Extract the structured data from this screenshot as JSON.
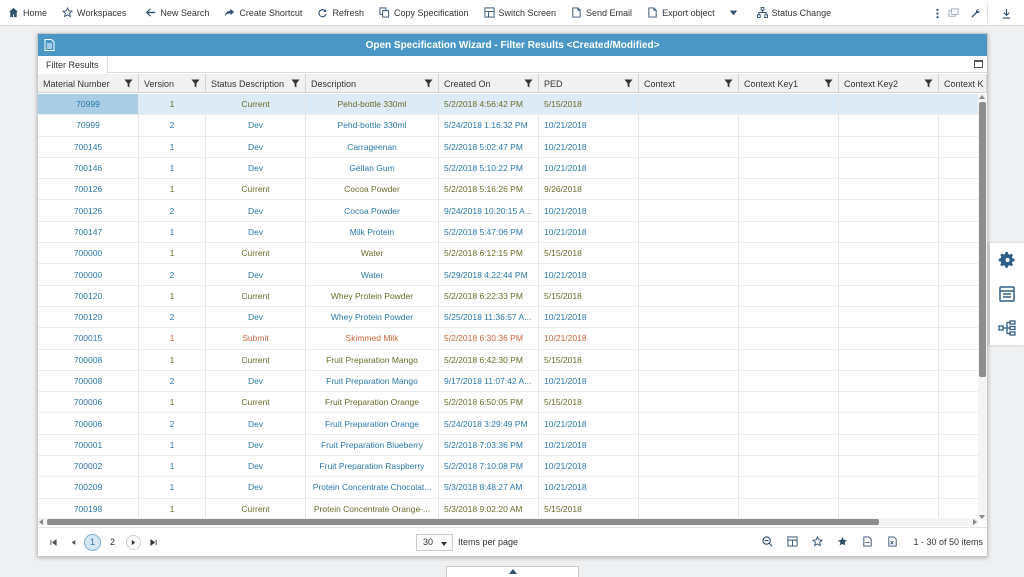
{
  "toolbar": {
    "items": [
      {
        "label": "Home",
        "icon": "home-icon"
      },
      {
        "label": "Workspaces",
        "icon": "star-icon"
      },
      {
        "label": "New Search",
        "icon": "arrow-left-icon"
      },
      {
        "label": "Create Shortcut",
        "icon": "shortcut-arrow-icon"
      },
      {
        "label": "Refresh",
        "icon": "refresh-icon"
      },
      {
        "label": "Copy Specification",
        "icon": "copy-icon"
      },
      {
        "label": "Switch Screen",
        "icon": "switch-screen-icon"
      },
      {
        "label": "Send Email",
        "icon": "email-icon"
      },
      {
        "label": "Export object",
        "icon": "export-icon"
      },
      {
        "label": "Status Change",
        "icon": "status-change-icon"
      }
    ]
  },
  "dialog": {
    "title": "Open Specification Wizard - Filter Results <Created/Modified>",
    "tab": "Filter Results"
  },
  "grid": {
    "columns": [
      "Material Number",
      "Version",
      "Status Description",
      "Description",
      "Created On",
      "PED",
      "Context",
      "Context Key1",
      "Context Key2",
      "Context K"
    ],
    "rows": [
      {
        "material": "70999",
        "version": "1",
        "status": "Current",
        "description": "Pehd-bottle 330ml",
        "created": "5/2/2018 4:56:42 PM",
        "ped": "5/15/2018",
        "color": "olive",
        "selected": true
      },
      {
        "material": "70999",
        "version": "2",
        "status": "Dev",
        "description": "Pehd-bottle 330ml",
        "created": "5/24/2018 1:16:32 PM",
        "ped": "10/21/2018",
        "color": "blue"
      },
      {
        "material": "700145",
        "version": "1",
        "status": "Dev",
        "description": "Carrageenan",
        "created": "5/2/2018 5:02:47 PM",
        "ped": "10/21/2018",
        "color": "blue"
      },
      {
        "material": "700146",
        "version": "1",
        "status": "Dev",
        "description": "Gellan Gum",
        "created": "5/2/2018 5:10:22 PM",
        "ped": "10/21/2018",
        "color": "blue"
      },
      {
        "material": "700126",
        "version": "1",
        "status": "Current",
        "description": "Cocoa Powder",
        "created": "5/2/2018 5:16:26 PM",
        "ped": "9/26/2018",
        "color": "olive"
      },
      {
        "material": "700126",
        "version": "2",
        "status": "Dev",
        "description": "Cocoa Powder",
        "created": "9/24/2018 10:20:15 A...",
        "ped": "10/21/2018",
        "color": "blue"
      },
      {
        "material": "700147",
        "version": "1",
        "status": "Dev",
        "description": "Milk Protein",
        "created": "5/2/2018 5:47:06 PM",
        "ped": "10/21/2018",
        "color": "blue"
      },
      {
        "material": "700000",
        "version": "1",
        "status": "Current",
        "description": "Water",
        "created": "5/2/2018 6:12:15 PM",
        "ped": "5/15/2018",
        "color": "olive"
      },
      {
        "material": "700000",
        "version": "2",
        "status": "Dev",
        "description": "Water",
        "created": "5/29/2018 4:22:44 PM",
        "ped": "10/21/2018",
        "color": "blue"
      },
      {
        "material": "700120",
        "version": "1",
        "status": "Current",
        "description": "Whey Protein Powder",
        "created": "5/2/2018 6:22:33 PM",
        "ped": "5/15/2018",
        "color": "olive"
      },
      {
        "material": "700120",
        "version": "2",
        "status": "Dev",
        "description": "Whey Protein Powder",
        "created": "5/25/2018 11:36:57 A...",
        "ped": "10/21/2018",
        "color": "blue"
      },
      {
        "material": "700015",
        "version": "1",
        "status": "Submit",
        "description": "Skimmed Milk",
        "created": "5/2/2018 6:30:36 PM",
        "ped": "10/21/2018",
        "color": "orange"
      },
      {
        "material": "700008",
        "version": "1",
        "status": "Current",
        "description": "Fruit Preparation Mango",
        "created": "5/2/2018 6:42:30 PM",
        "ped": "5/15/2018",
        "color": "olive"
      },
      {
        "material": "700008",
        "version": "2",
        "status": "Dev",
        "description": "Fruit Preparation Mango",
        "created": "9/17/2018 11:07:42 A...",
        "ped": "10/21/2018",
        "color": "blue"
      },
      {
        "material": "700006",
        "version": "1",
        "status": "Current",
        "description": "Fruit Preparation Orange",
        "created": "5/2/2018 6:50:05 PM",
        "ped": "5/15/2018",
        "color": "olive"
      },
      {
        "material": "700006",
        "version": "2",
        "status": "Dev",
        "description": "Fruit Preparation Orange",
        "created": "5/24/2018 3:29:49 PM",
        "ped": "10/21/2018",
        "color": "blue"
      },
      {
        "material": "700001",
        "version": "1",
        "status": "Dev",
        "description": "Fruit Preparation Blueberry",
        "created": "5/2/2018 7:03:36 PM",
        "ped": "10/21/2018",
        "color": "blue"
      },
      {
        "material": "700002",
        "version": "1",
        "status": "Dev",
        "description": "Fruit Preparation Raspberry",
        "created": "5/2/2018 7:10:08 PM",
        "ped": "10/21/2018",
        "color": "blue"
      },
      {
        "material": "700209",
        "version": "1",
        "status": "Dev",
        "description": "Protein Concentrate Chocolat...",
        "created": "5/3/2018 8:48:27 AM",
        "ped": "10/21/2018",
        "color": "blue"
      },
      {
        "material": "700198",
        "version": "1",
        "status": "Current",
        "description": "Protein Concentrate Orange-...",
        "created": "5/3/2018 9:02:20 AM",
        "ped": "5/15/2018",
        "color": "olive"
      }
    ]
  },
  "pager": {
    "pages": [
      "1",
      "2"
    ],
    "current_page": "1",
    "per_page": "30",
    "per_page_label": "Items per page",
    "count": "1 - 30 of 50 items"
  },
  "colors": {
    "title_bar": "#4a97c6",
    "link_blue": "#2b78a8",
    "current_olive": "#6b6b2a",
    "submit_orange": "#c8653a",
    "selected_row": "#dcebf5"
  }
}
